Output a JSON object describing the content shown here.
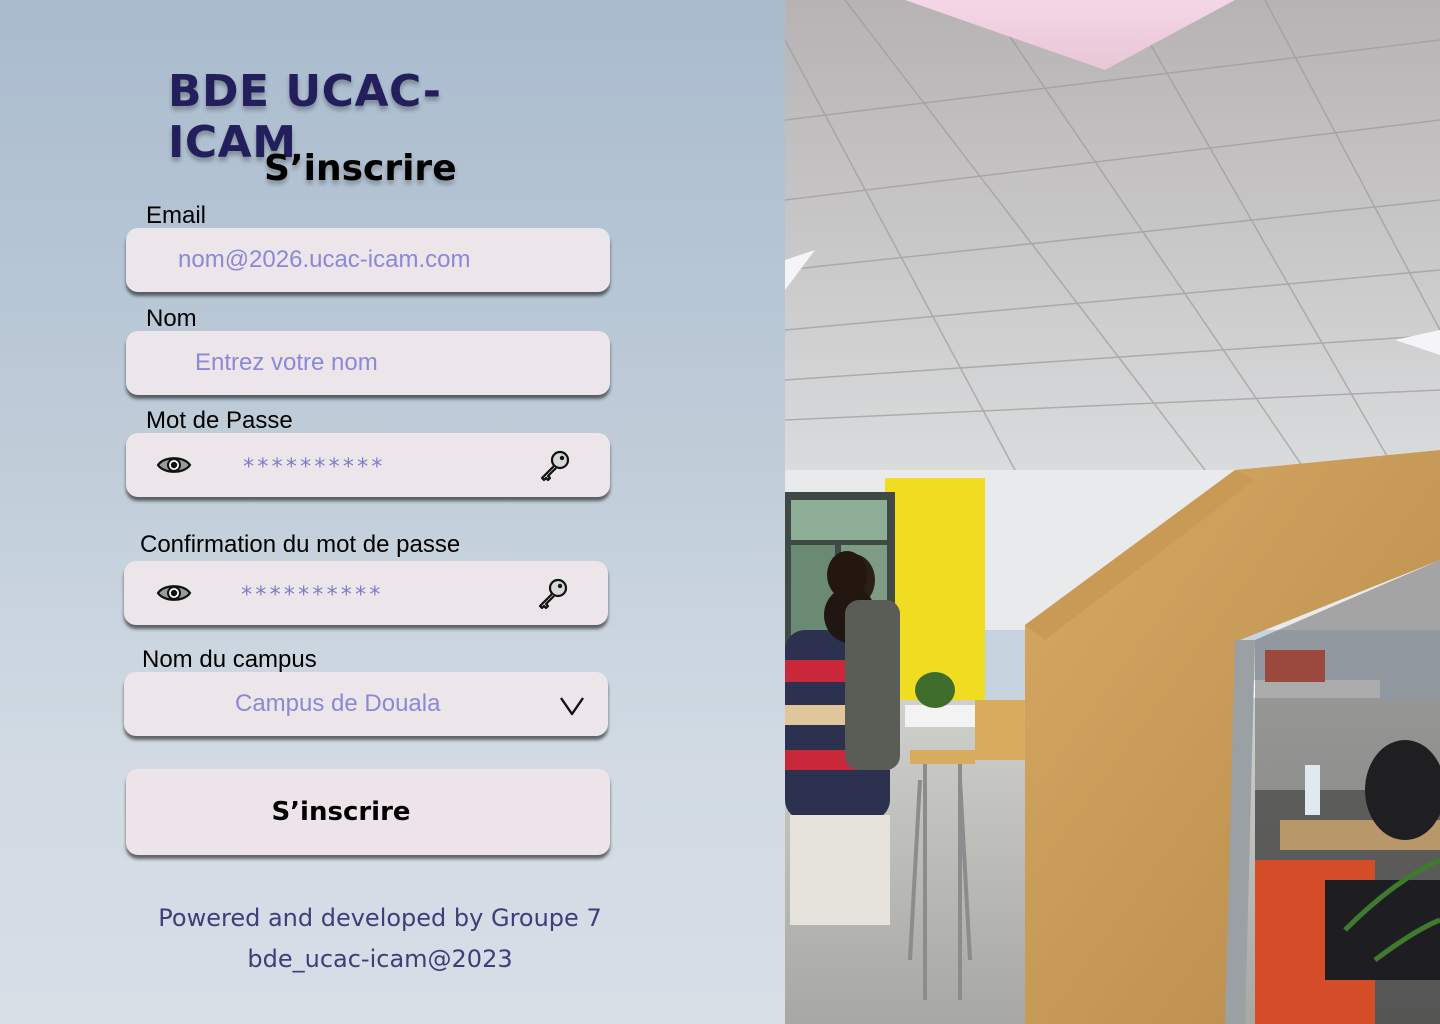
{
  "brand": {
    "title": "BDE UCAC-ICAM"
  },
  "form": {
    "title": "S’inscrire",
    "email": {
      "label": "Email",
      "placeholder": "nom@2026.ucac-icam.com"
    },
    "name": {
      "label": "Nom",
      "placeholder": "Entrez votre nom"
    },
    "password": {
      "label": "Mot de Passe",
      "value": "**********",
      "toggle_icon": "eye-icon",
      "key_icon": "key-icon"
    },
    "password_confirm": {
      "label": "Confirmation du mot de passe",
      "value": "**********",
      "toggle_icon": "eye-icon",
      "key_icon": "key-icon"
    },
    "campus": {
      "label": "Nom du campus",
      "selected": "Campus de Douala",
      "icon": "chevron-down-icon"
    },
    "submit_label": "S’inscrire"
  },
  "footer": {
    "line1": "Powered and developed by  Groupe 7",
    "line2": "bde_ucac-icam@2023"
  },
  "colors": {
    "brand": "#231f5c",
    "placeholder": "#8b88d6",
    "field_bg": "#ece6ea",
    "footer": "#3e3f7a"
  }
}
